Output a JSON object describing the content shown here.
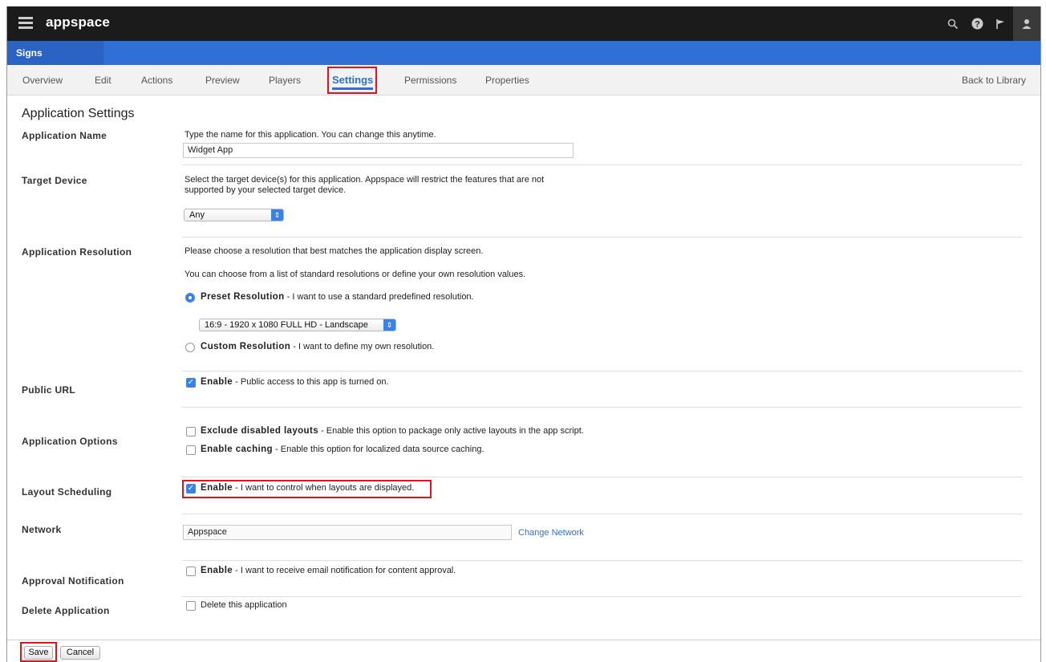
{
  "app": {
    "logo": "appspace",
    "section": "Signs"
  },
  "tabs": [
    "Overview",
    "Edit",
    "Actions",
    "Preview",
    "Players",
    "Settings",
    "Permissions",
    "Properties"
  ],
  "back_to_library": "Back to Library",
  "page_title": "Application Settings",
  "app_name": {
    "label": "Application Name",
    "help": "Type the name for this application. You can change this anytime.",
    "value": "Widget App"
  },
  "target_device": {
    "label": "Target Device",
    "help1": "Select the target device(s) for this application. Appspace will restrict the features that are not",
    "help2": "supported by your selected target device.",
    "selected": "Any"
  },
  "resolution": {
    "label": "Application Resolution",
    "help1": "Please choose a resolution that best matches the application display screen.",
    "help2": "You can choose from a list of standard resolutions or define your own resolution values.",
    "preset_title": "Preset Resolution",
    "preset_desc": " - I want to use a standard predefined resolution.",
    "preset_selected": "16:9 - 1920 x 1080 FULL HD - Landscape",
    "custom_title": "Custom Resolution",
    "custom_desc": " - I want to define my own resolution."
  },
  "public_url": {
    "label": "Public URL",
    "title": "Enable",
    "desc": " - Public access to this app is turned on.",
    "checked": true
  },
  "app_options": {
    "label": "Application Options",
    "opt1_title": "Exclude disabled layouts",
    "opt1_desc": " - Enable this option to package only active layouts in the app script.",
    "opt2_title": "Enable caching",
    "opt2_desc": " - Enable this option for localized data source caching."
  },
  "layout_scheduling": {
    "label": "Layout Scheduling",
    "title": "Enable",
    "desc": " - I want to control when layouts are displayed.",
    "checked": true
  },
  "network": {
    "label": "Network",
    "value": "Appspace",
    "link": "Change Network"
  },
  "approval": {
    "label": "Approval Notification",
    "title": "Enable",
    "desc": " - I want to receive email notification for content approval.",
    "checked": false
  },
  "delete_app": {
    "label": "Delete Application",
    "desc": "Delete this application",
    "checked": false
  },
  "buttons": {
    "save": "Save",
    "cancel": "Cancel"
  },
  "colors": {
    "accent": "#2f6fd6",
    "highlight": "#e1141b",
    "topbar": "#1b1b1b"
  }
}
